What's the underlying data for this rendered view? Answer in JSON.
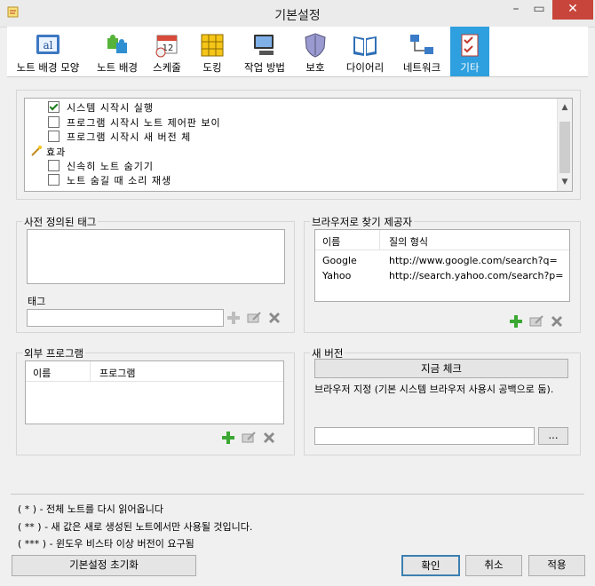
{
  "window": {
    "title": "기본설정",
    "min": "–",
    "max": "▭",
    "close": "✕"
  },
  "toolbar": [
    {
      "label": "노트 배경 모양",
      "icon": "note-background-style-icon"
    },
    {
      "label": "노트 배경",
      "icon": "puzzle-icon"
    },
    {
      "label": "스케줄",
      "icon": "calendar-clock-icon"
    },
    {
      "label": "도킹",
      "icon": "docking-grid-icon"
    },
    {
      "label": "작업 방법",
      "icon": "computer-icon"
    },
    {
      "label": "보호",
      "icon": "shield-icon"
    },
    {
      "label": "다이어리",
      "icon": "book-icon"
    },
    {
      "label": "네트워크",
      "icon": "network-icon"
    },
    {
      "label": "기타",
      "icon": "checklist-icon"
    }
  ],
  "options": {
    "items": [
      {
        "label": "시스템 시작시 실행",
        "checked": true
      },
      {
        "label": "프로그램 시작시 노트 제어판 보이",
        "checked": false
      },
      {
        "label": "프로그램 시작시 새 버전 체",
        "checked": false
      },
      {
        "label": "효과",
        "group": true
      },
      {
        "label": "신속히 노트 숨기기",
        "checked": false
      },
      {
        "label": "노트 숨길 때 소리 재생",
        "checked": false
      }
    ]
  },
  "tags": {
    "title": "사전 정의된 태그",
    "tag_label": "태그",
    "input_value": ""
  },
  "search": {
    "title": "브라우저로 찾기 제공자",
    "col_name": "이름",
    "col_query": "질의 형식",
    "rows": [
      {
        "name": "Google",
        "query": "http://www.google.com/search?q="
      },
      {
        "name": "Yahoo",
        "query": "http://search.yahoo.com/search?p="
      }
    ]
  },
  "external": {
    "title": "외부 프로그램",
    "col_name": "이름",
    "col_program": "프로그램"
  },
  "newver": {
    "title": "새 버전",
    "check_button": "지금 체크",
    "browser_text": "브라우저 지정 (기본 시스템 브라우저 사용시 공백으로 둠).",
    "browse_button": "...",
    "browser_value": ""
  },
  "notes": {
    "n1": "( * ) - 전체 노트를 다시 읽어옵니다",
    "n2": "( ** ) - 새 값은 새로 생성된 노트에서만 사용될 것입니다.",
    "n3": "( *** ) - 윈도우 비스타 이상 버전이 요구됨"
  },
  "buttons": {
    "reset": "기본설정 초기화",
    "ok": "확인",
    "cancel": "취소",
    "apply": "적용"
  },
  "colors": {
    "accent": "#2e9fdf",
    "close": "#c7453a",
    "add_green": "#3aa832",
    "delete_gray": "#8a8a8a"
  }
}
